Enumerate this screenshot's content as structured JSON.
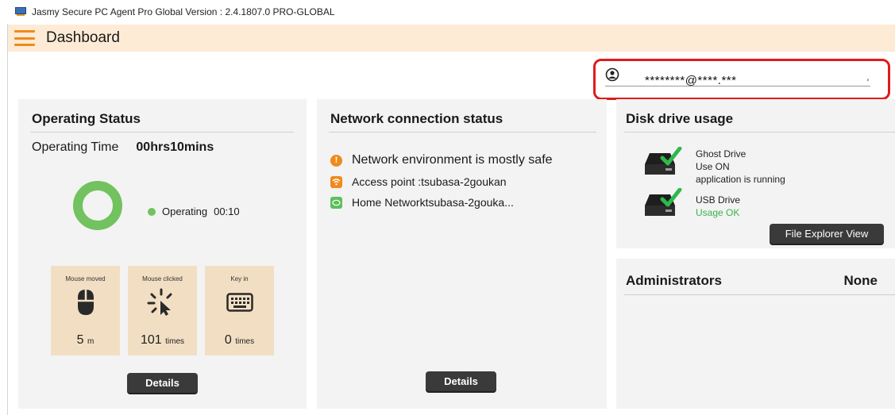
{
  "window": {
    "title": "Jasmy Secure PC Agent Pro Global Version : 2.4.1807.0 PRO-GLOBAL"
  },
  "header": {
    "title": "Dashboard"
  },
  "account": {
    "email": "********@****.***",
    "mark": "'"
  },
  "operating": {
    "title": "Operating Status",
    "time_label": "Operating Time",
    "time_value": "00hrs10mins",
    "status_label": "Operating",
    "status_value": "00:10",
    "status_color": "#72c25f",
    "stats": [
      {
        "label": "Mouse moved",
        "value": "5",
        "unit": "m",
        "icon": "mouse-icon"
      },
      {
        "label": "Mouse clicked",
        "value": "101",
        "unit": "times",
        "icon": "click-icon"
      },
      {
        "label": "Key in",
        "value": "0",
        "unit": "times",
        "icon": "keyboard-icon"
      }
    ],
    "details_label": "Details"
  },
  "network": {
    "title": "Network connection status",
    "environment": "Network environment is mostly safe",
    "access_point": "Access point :tsubasa-2goukan",
    "home_network": "Home Networktsubasa-2gouka...",
    "details_label": "Details"
  },
  "disk": {
    "title": "Disk drive usage",
    "ghost": {
      "name": "Ghost Drive",
      "line2": "Use ON",
      "line3": "application is running"
    },
    "usb": {
      "name": "USB Drive",
      "status": "Usage OK"
    },
    "explorer_label": "File Explorer View"
  },
  "admin": {
    "title": "Administrators",
    "value": "None"
  },
  "colors": {
    "accent": "#f08a1c",
    "header_bg": "#fdebd5",
    "highlight": "#e01b1b",
    "ok": "#3bb34a"
  }
}
